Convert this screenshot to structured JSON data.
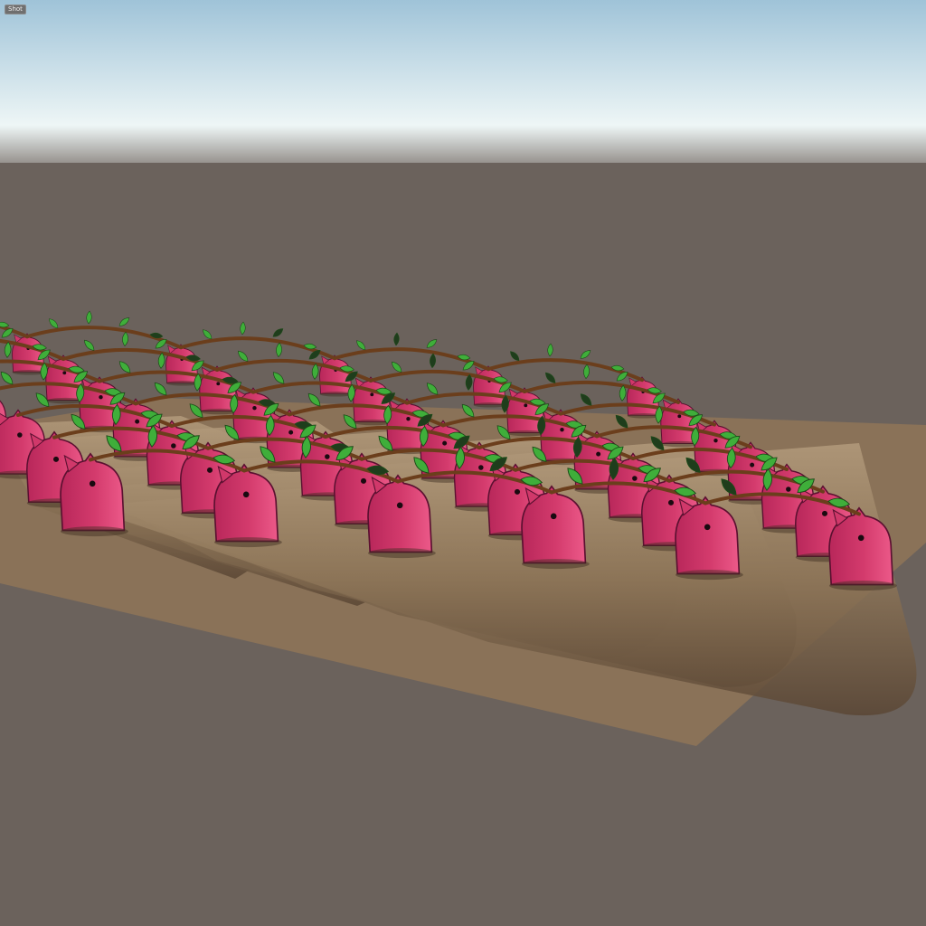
{
  "toolbar": {
    "shot_label": "Shot"
  },
  "scene": {
    "sky_top_color": "#9fc3d8",
    "sky_horizon_color": "#eef6f6",
    "ground_color": "#6b625c",
    "soil_color": "#8a7258",
    "ridge_color": "#937b5f",
    "creature_color": "#d0386a",
    "leaf_color": "#3fae3a",
    "vine_color": "#6b3e1c",
    "rows": 6,
    "creatures_per_row": 7
  }
}
